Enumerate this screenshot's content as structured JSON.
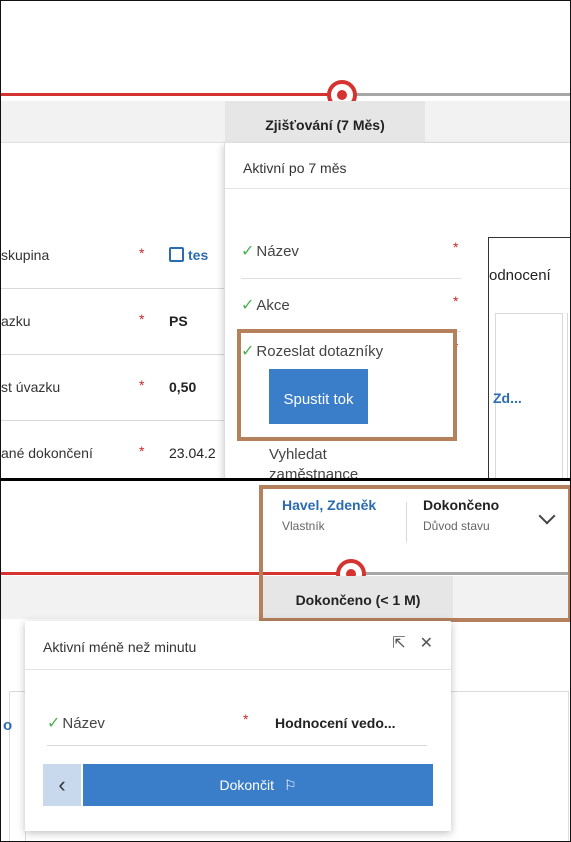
{
  "top": {
    "stage_label": "Zjišťování (7 Měs)",
    "fields": [
      {
        "label": "skupina",
        "required": "*",
        "value": "tes",
        "type": "lookup"
      },
      {
        "label": "azku",
        "required": "*",
        "value": "PS",
        "type": "text"
      },
      {
        "label": "st úvazku",
        "required": "*",
        "value": "0,50",
        "type": "text"
      },
      {
        "label": "ané dokončení",
        "required": "*",
        "value": "23.04.2",
        "type": "date"
      }
    ],
    "flyout": {
      "header": "Aktivní po 7 měs",
      "steps": [
        {
          "label": "Název",
          "required": "*"
        },
        {
          "label": "Akce",
          "required": "*"
        },
        {
          "label": "Rozeslat dotazníky",
          "required": "*"
        }
      ],
      "run_button": "Spustit tok",
      "next_step": "Vyhledat zaměstnance"
    },
    "side_panel": {
      "title": "odnocení",
      "link": "Zd..."
    }
  },
  "bottom": {
    "owner": {
      "name": "Havel, Zdeněk",
      "label": "Vlastník"
    },
    "status": {
      "name": "Dokončeno",
      "label": "Důvod stavu"
    },
    "stage_label": "Dokončeno (< 1 M)",
    "flyout": {
      "header": "Aktivní méně než minutu",
      "step_label": "Název",
      "required": "*",
      "step_value": "Hodnocení vedo...",
      "finish_button": "Dokončit"
    }
  },
  "colors": {
    "accent": "#3a7dc9",
    "stage_red": "#d4332f",
    "highlight": "#b5805c",
    "check_green": "#4caf50"
  },
  "icons": {
    "back": "chevron-left-icon",
    "finish": "flag-icon",
    "expand": "expand-icon",
    "close": "close-icon"
  }
}
